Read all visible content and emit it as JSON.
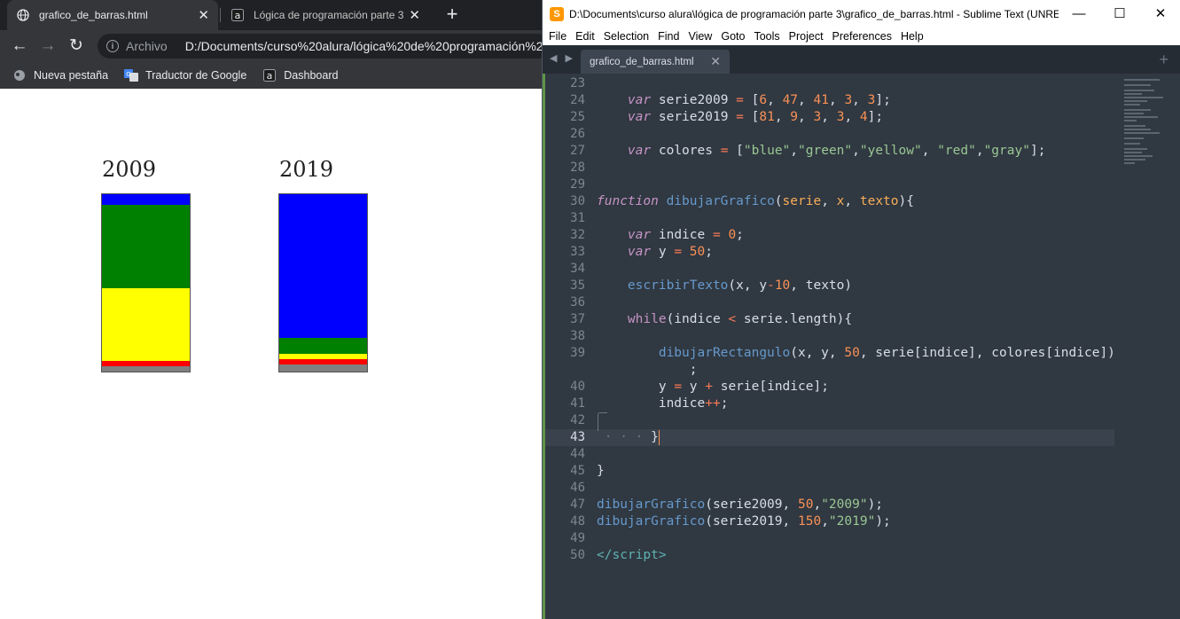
{
  "browser": {
    "tabs": [
      {
        "title": "grafico_de_barras.html",
        "active": true
      },
      {
        "title": "Lógica de programación parte 3:",
        "active": false
      }
    ],
    "toolbar": {
      "scheme": "Archivo",
      "url": "D:/Documents/curso%20alura/lógica%20de%20programación%20"
    },
    "bookmarks": [
      {
        "label": "Nueva pestaña"
      },
      {
        "label": "Traductor de Google"
      },
      {
        "label": "Dashboard"
      }
    ],
    "page": {
      "charts": [
        {
          "label": "2009",
          "series": [
            6,
            47,
            41,
            3,
            3
          ]
        },
        {
          "label": "2019",
          "series": [
            81,
            9,
            3,
            3,
            4
          ]
        }
      ],
      "colors": [
        "blue",
        "green",
        "yellow",
        "red",
        "gray"
      ]
    }
  },
  "sublime": {
    "title": "D:\\Documents\\curso alura\\lógica de programación parte 3\\grafico_de_barras.html - Sublime Text (UNRE...",
    "menu": [
      "File",
      "Edit",
      "Selection",
      "Find",
      "View",
      "Goto",
      "Tools",
      "Project",
      "Preferences",
      "Help"
    ],
    "tab_name": "grafico_de_barras.html",
    "current_line": 43,
    "line_numbers": [
      "23",
      "24",
      "25",
      "26",
      "27",
      "28",
      "29",
      "30",
      "31",
      "32",
      "33",
      "34",
      "35",
      "36",
      "37",
      "38",
      "39",
      "",
      "40",
      "41",
      "42",
      "43",
      "44",
      "45",
      "46",
      "47",
      "48",
      "49",
      "50"
    ]
  }
}
